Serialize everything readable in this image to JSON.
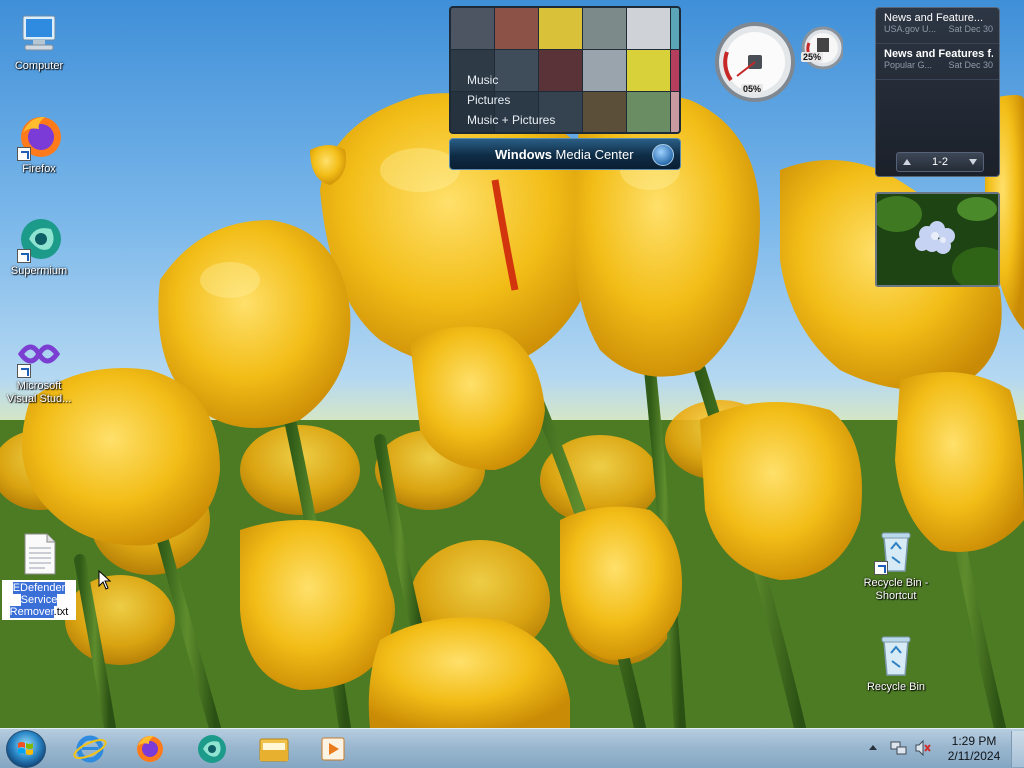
{
  "desktop": {
    "icons": [
      {
        "label": "Computer",
        "icon": "computer-icon"
      },
      {
        "label": "Firefox",
        "icon": "firefox-icon"
      },
      {
        "label": "Supermium",
        "icon": "supermium-icon"
      },
      {
        "label": "Microsoft Visual Stud...",
        "icon": "visual-studio-icon"
      },
      {
        "label_parts": [
          "EDefender Service Remover",
          ".txt"
        ],
        "icon": "text-file-icon"
      },
      {
        "label": "Recycle Bin - Shortcut",
        "icon": "recycle-bin-icon"
      },
      {
        "label": "Recycle Bin",
        "icon": "recycle-bin-icon"
      }
    ]
  },
  "media_center": {
    "menu": [
      "Music",
      "Pictures",
      "Music + Pictures"
    ],
    "title_bold": "Windows",
    "title_rest": " Media Center"
  },
  "cpu_meter": {
    "cpu_percent": "05%",
    "memory_percent": "25%"
  },
  "feed": {
    "items": [
      {
        "title": "News and Feature...",
        "source": "USA.gov U...",
        "date": "Sat Dec 30",
        "bold": false
      },
      {
        "title": "News and Features f...",
        "source": "Popular G...",
        "date": "Sat Dec 30",
        "bold": true
      }
    ],
    "pager": "1-2"
  },
  "taskbar": {
    "pinned": [
      "internet-explorer-icon",
      "firefox-icon",
      "supermium-icon",
      "file-explorer-icon",
      "media-player-icon"
    ],
    "clock_time": "1:29 PM",
    "clock_date": "2/11/2024"
  },
  "colors": {
    "taskbar": "#9ab7cf",
    "selection": "#3a6fd8",
    "tulip": "#f5c21b",
    "sky": "#7ab7ea"
  }
}
